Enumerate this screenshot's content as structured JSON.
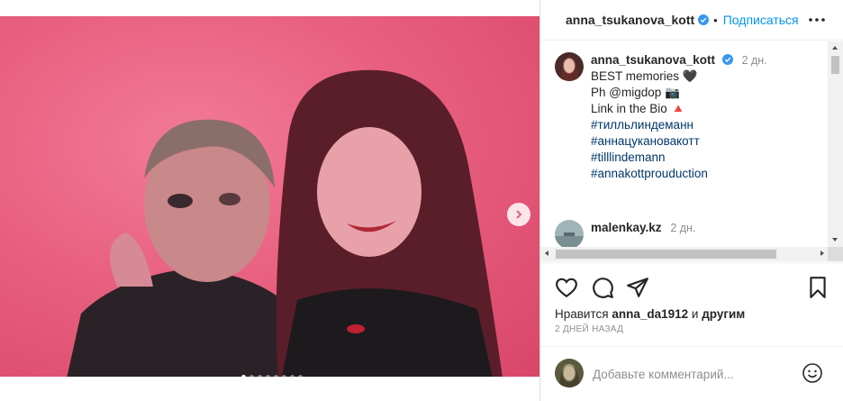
{
  "post": {
    "author": "anna_tsukanova_kott",
    "follow_label": "Подписаться",
    "dot": "•",
    "carousel_count": 8,
    "carousel_active": 0
  },
  "caption": {
    "username": "anna_tsukanova_kott",
    "time": "2 дн.",
    "line1": "BEST memories 🖤",
    "line2": "Ph @migdop 📷",
    "line3": "Link in the Bio 🔺",
    "hashtags": [
      "#тилльлиндеманн",
      "#аннацукановакотт",
      "#tilllindemann",
      "#annakottprouduction"
    ]
  },
  "comment": {
    "username": "malenkay.kz",
    "time": "2 дн."
  },
  "likes": {
    "prefix": "Нравится",
    "user": "anna_da1912",
    "middle": "и",
    "suffix": "другим"
  },
  "timestamp": "2 ДНЕЙ НАЗАД",
  "add_comment": {
    "placeholder": "Добавьте комментарий..."
  },
  "colors": {
    "accent": "#0095f6",
    "verified": "#3897f0",
    "photo_bg": "#e8607f"
  }
}
